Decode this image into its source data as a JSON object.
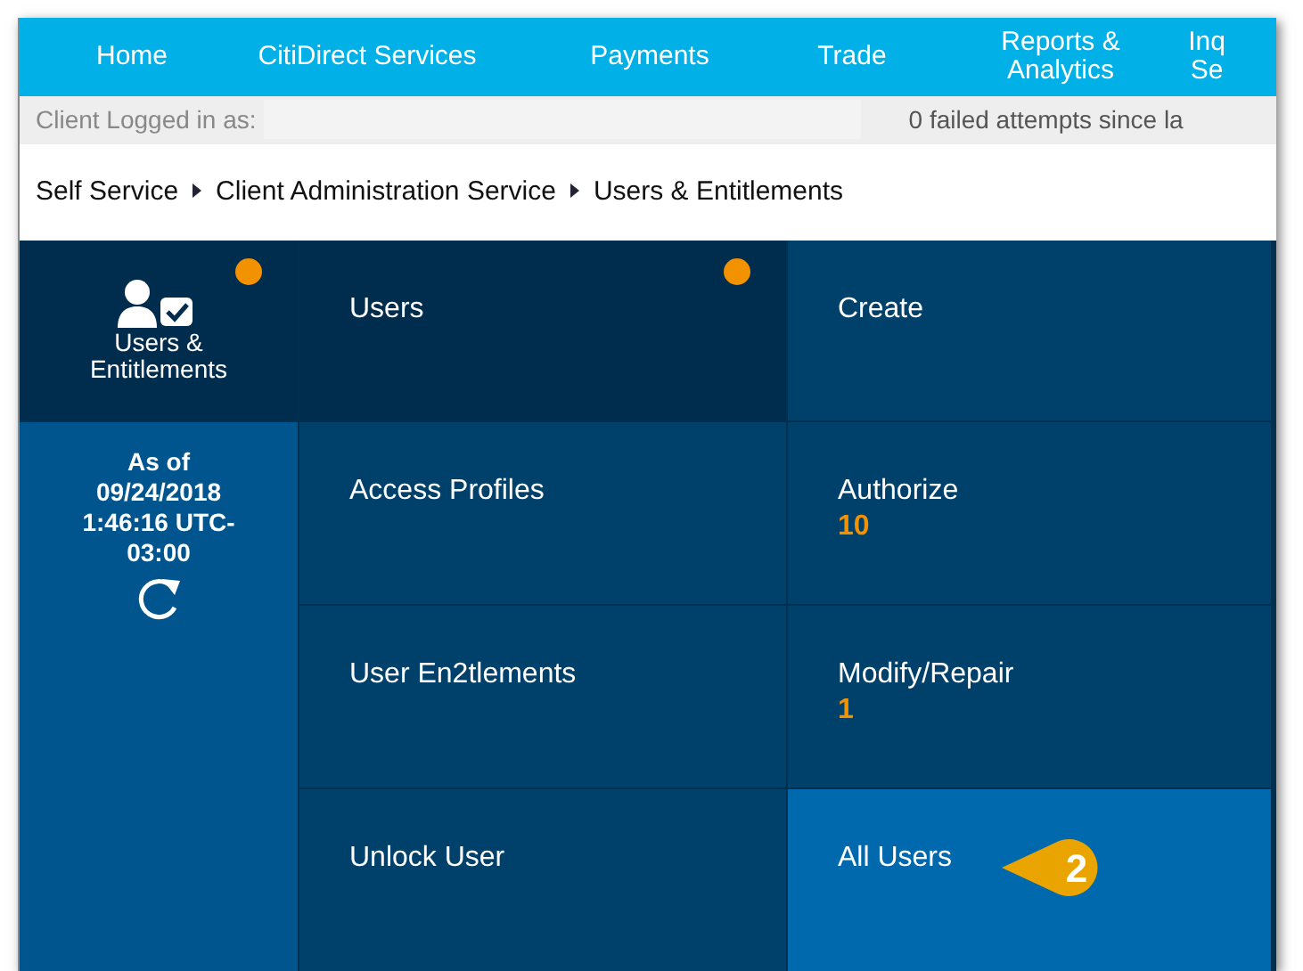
{
  "nav": [
    {
      "label": "Home"
    },
    {
      "label": "CitiDirect Services"
    },
    {
      "label": "Payments"
    },
    {
      "label": "Trade"
    },
    {
      "label": "Reports & Analytics"
    },
    {
      "label": "Inq Se"
    }
  ],
  "status_bar": {
    "client_label": "Client Logged in as:",
    "attempts": "0 failed attempts since la"
  },
  "breadcrumb": [
    "Self Service",
    "Client Administration Service",
    "Users & Entitlements"
  ],
  "module": {
    "label": "Users & Entitlements",
    "as_of": "As of 09/24/2018 1:46:16 UTC-03:00",
    "notification": true
  },
  "menu": [
    {
      "label": "Users",
      "selected": true,
      "notification": true
    },
    {
      "label": "Access Profiles",
      "selected": false,
      "notification": false
    },
    {
      "label": "User En2tlements",
      "selected": false,
      "notification": false
    },
    {
      "label": "Unlock User",
      "selected": false,
      "notification": false
    }
  ],
  "actions": [
    {
      "label": "Create",
      "selected": false
    },
    {
      "label": "Authorize",
      "count": "10",
      "selected": false
    },
    {
      "label": "Modify/Repair",
      "count": "1",
      "selected": false
    },
    {
      "label": "All Users",
      "selected": true,
      "callout": "2"
    }
  ]
}
